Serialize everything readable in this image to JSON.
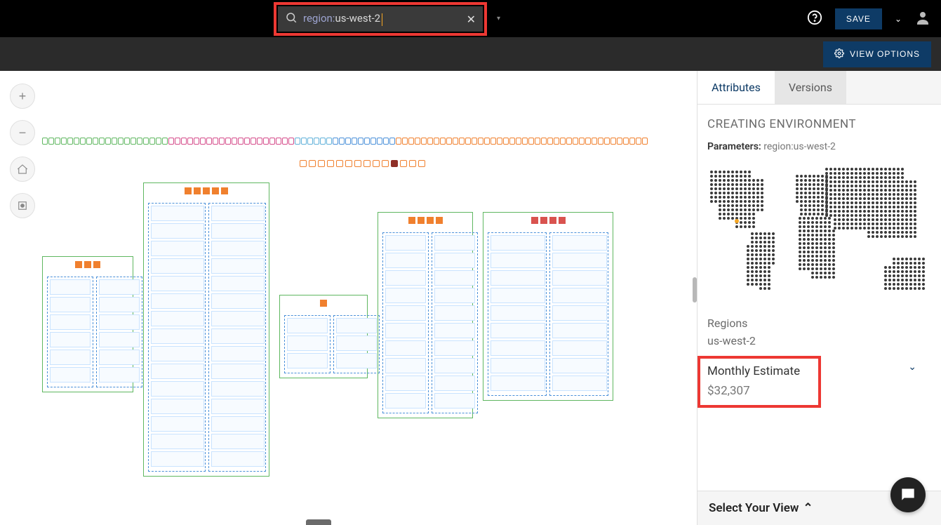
{
  "header": {
    "search_prefix": "region:",
    "search_value": "us-west-2",
    "save_label": "SAVE"
  },
  "subheader": {
    "view_options_label": "VIEW OPTIONS"
  },
  "panel": {
    "tabs": {
      "attributes": "Attributes",
      "versions": "Versions"
    },
    "env_title": "CREATING ENVIRONMENT",
    "params_label": "Parameters:",
    "params_value": "region:us-west-2",
    "regions_label": "Regions",
    "regions_value": "us-west-2",
    "estimate_label": "Monthly Estimate",
    "estimate_value": "$32,307",
    "select_view_label": "Select Your View"
  },
  "colors": {
    "highlight": "#ed3833",
    "accent": "#0e3b66"
  }
}
